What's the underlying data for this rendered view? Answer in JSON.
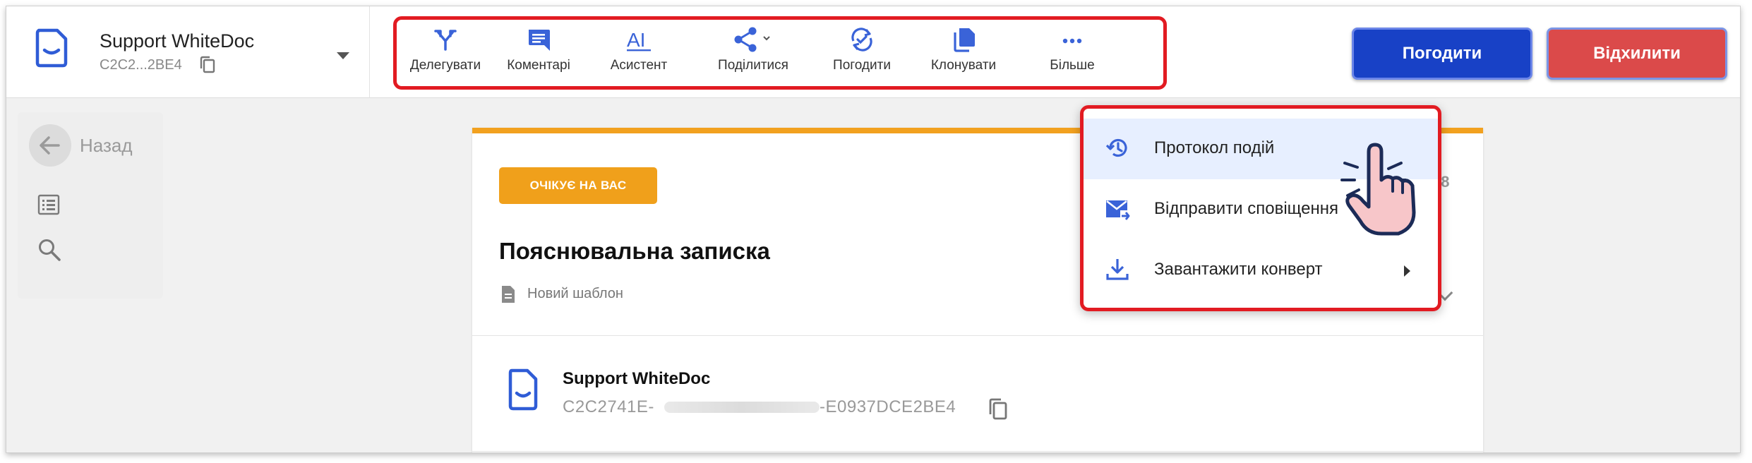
{
  "header": {
    "doc_name": "Support WhiteDoc",
    "doc_code": "C2C2...2BE4",
    "toolbar": [
      {
        "label": "Делегувати",
        "icon": "delegate-icon"
      },
      {
        "label": "Коментарі",
        "icon": "comment-icon"
      },
      {
        "label": "Асистент",
        "icon": "ai-assistant-icon"
      },
      {
        "label": "Поділитися",
        "icon": "share-icon"
      },
      {
        "label": "Погодити",
        "icon": "approve-sync-icon"
      },
      {
        "label": "Клонувати",
        "icon": "clone-icon"
      },
      {
        "label": "Більше",
        "icon": "more-icon"
      }
    ],
    "approve_label": "Погодити",
    "reject_label": "Відхилити"
  },
  "sidebar": {
    "back_label": "Назад"
  },
  "document": {
    "status": "ОЧІКУЄ НА ВАС",
    "title": "Пояснювальна записка",
    "template": "Новий шаблон",
    "partial_number": "48",
    "signer": {
      "name": "Support WhiteDoc",
      "code_start": "C2C2741E-",
      "code_end": "-E0937DCE2BE4"
    }
  },
  "more_menu": {
    "items": [
      {
        "label": "Протокол подій",
        "icon": "history-icon"
      },
      {
        "label": "Відправити сповіщення",
        "icon": "mail-send-icon"
      },
      {
        "label": "Завантажити конверт",
        "icon": "download-icon"
      }
    ]
  },
  "colors": {
    "primary": "#1841c6",
    "reject": "#db4a4a",
    "status": "#f0a01b",
    "highlight": "#e21b22",
    "icon_blue": "#3a63d8"
  }
}
